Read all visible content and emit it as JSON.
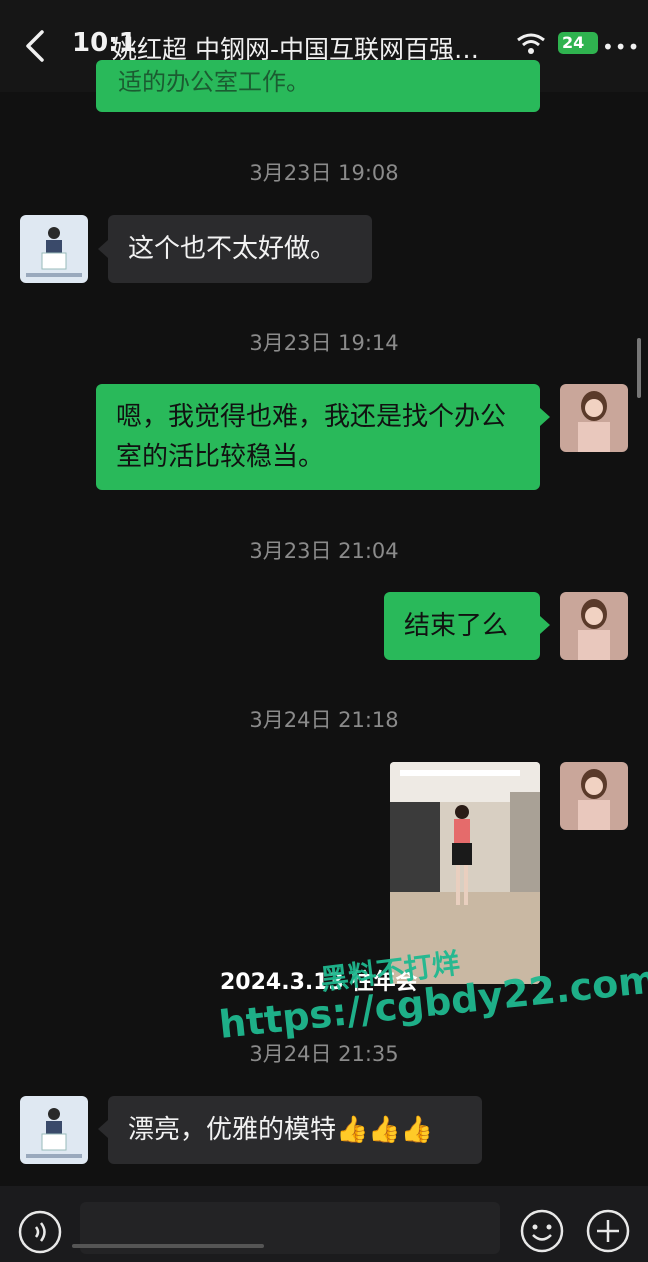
{
  "status": {
    "time": "10:1",
    "battery": "24"
  },
  "header": {
    "title": "姚红超 中钢网-中国互联网百强…",
    "more": "•••"
  },
  "previous_message_fragment": "适的办公室工作。",
  "messages": [
    {
      "timestamp": "3月23日 19:08",
      "side": "in",
      "text": "这个也不太好做。"
    },
    {
      "timestamp": "3月23日 19:14",
      "side": "out",
      "text": "嗯，我觉得也难，我还是找个办公室的活比较稳当。"
    },
    {
      "timestamp": "3月23日 21:04",
      "side": "out",
      "text": "结束了么"
    },
    {
      "timestamp": "3月24日 21:18",
      "side": "out",
      "text": ""
    },
    {
      "timestamp": "3月24日 21:35",
      "side": "in",
      "text": "漂亮，优雅的模特👍👍👍"
    }
  ],
  "photo_caption": "2024.3.13 往年会",
  "watermark": {
    "line1": "黑料不打烊",
    "line2": "https://cgbdy22.com"
  },
  "colors": {
    "outgoing_bubble": "#29b95a",
    "incoming_bubble": "#2b2b2d",
    "background": "#111111",
    "watermark": "#1fb88f"
  },
  "icons": [
    "back-icon",
    "wifi-icon",
    "battery-icon",
    "voice-icon",
    "emoji-icon",
    "plus-icon"
  ]
}
